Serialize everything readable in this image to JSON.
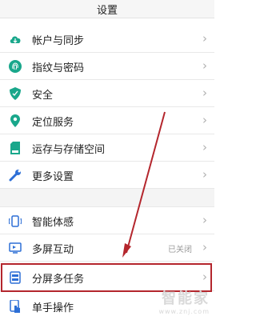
{
  "header": {
    "title": "设置"
  },
  "groups": [
    {
      "items": [
        {
          "label": "帐户与同步",
          "icon": "cloud-icon",
          "color": "#19a78b"
        },
        {
          "label": "指纹与密码",
          "icon": "fingerprint-icon",
          "color": "#19a78b"
        },
        {
          "label": "安全",
          "icon": "shield-icon",
          "color": "#19a78b"
        },
        {
          "label": "定位服务",
          "icon": "location-pin-icon",
          "color": "#19a78b"
        },
        {
          "label": "运存与存储空间",
          "icon": "storage-icon",
          "color": "#19a78b"
        },
        {
          "label": "更多设置",
          "icon": "wrench-icon",
          "color": "#2d6fd6"
        }
      ]
    },
    {
      "items": [
        {
          "label": "智能体感",
          "icon": "smart-motion-icon",
          "color": "#2d6fd6"
        },
        {
          "label": "多屏互动",
          "icon": "multi-screen-icon",
          "color": "#2d6fd6",
          "status": "已关闭"
        },
        {
          "label": "分屏多任务",
          "icon": "split-screen-icon",
          "color": "#2d6fd6"
        },
        {
          "label": "单手操作",
          "icon": "one-hand-icon",
          "color": "#2d6fd6"
        }
      ]
    }
  ],
  "chevron": "›",
  "annotation": {
    "color": "#b4262d"
  },
  "watermark": {
    "text": "智能家",
    "url": "www.znj.com"
  }
}
